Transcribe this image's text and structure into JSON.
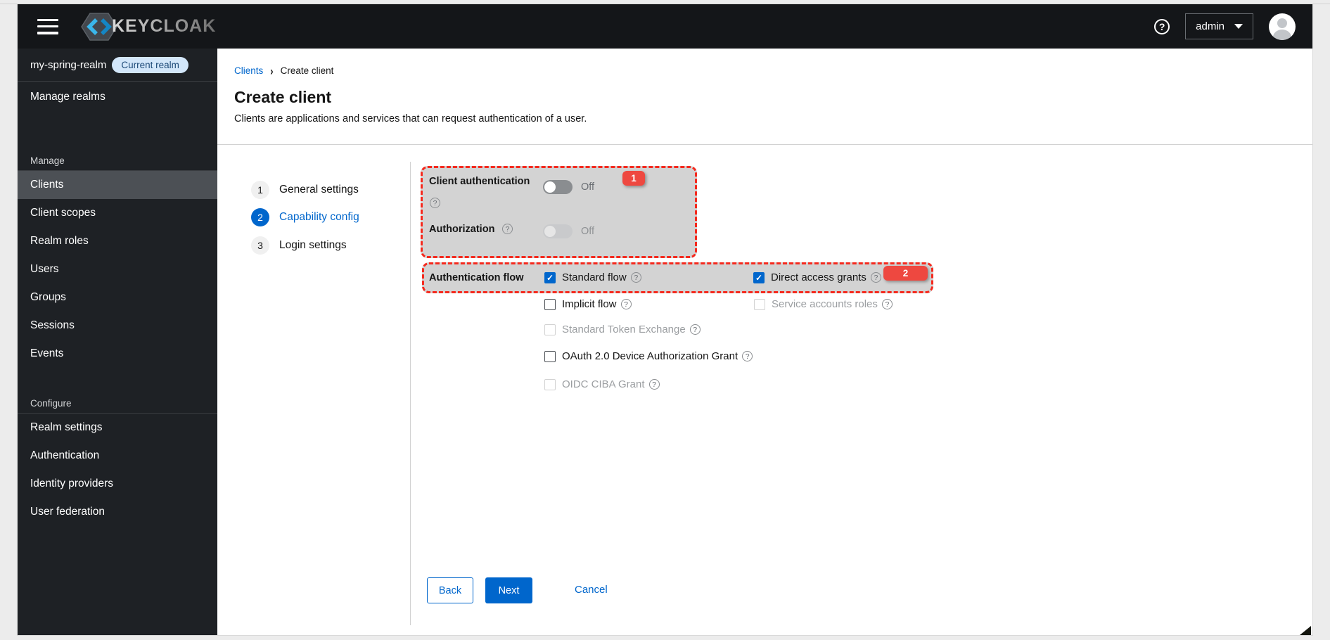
{
  "masthead": {
    "brand": "KEYCLOAK",
    "user_menu": "admin"
  },
  "sidebar": {
    "realm": {
      "name": "my-spring-realm",
      "badge": "Current realm"
    },
    "manage_realms": "Manage realms",
    "manage_group": {
      "label": "Manage",
      "items": [
        {
          "label": "Clients",
          "active": true
        },
        {
          "label": "Client scopes",
          "active": false
        },
        {
          "label": "Realm roles",
          "active": false
        },
        {
          "label": "Users",
          "active": false
        },
        {
          "label": "Groups",
          "active": false
        },
        {
          "label": "Sessions",
          "active": false
        },
        {
          "label": "Events",
          "active": false
        }
      ]
    },
    "configure_group": {
      "label": "Configure",
      "items": [
        {
          "label": "Realm settings",
          "active": false
        },
        {
          "label": "Authentication",
          "active": false
        },
        {
          "label": "Identity providers",
          "active": false
        },
        {
          "label": "User federation",
          "active": false
        }
      ]
    }
  },
  "breadcrumb": {
    "parent": "Clients",
    "current": "Create client"
  },
  "page": {
    "title": "Create client",
    "description": "Clients are applications and services that can request authentication of a user."
  },
  "wizard": {
    "steps": [
      {
        "num": "1",
        "label": "General settings",
        "active": false
      },
      {
        "num": "2",
        "label": "Capability config",
        "active": true
      },
      {
        "num": "3",
        "label": "Login settings",
        "active": false
      }
    ]
  },
  "form": {
    "client_auth": {
      "label": "Client authentication",
      "value": "Off",
      "disabled": false
    },
    "authorization": {
      "label": "Authorization",
      "value": "Off",
      "disabled": true
    },
    "auth_flow_label": "Authentication flow",
    "checkboxes": [
      {
        "label": "Standard flow",
        "checked": true,
        "disabled": false
      },
      {
        "label": "Direct access grants",
        "checked": true,
        "disabled": false
      },
      {
        "label": "Implicit flow",
        "checked": false,
        "disabled": false
      },
      {
        "label": "Service accounts roles",
        "checked": false,
        "disabled": true
      },
      {
        "label": "Standard Token Exchange",
        "checked": false,
        "disabled": true
      },
      {
        "label": "OAuth 2.0 Device Authorization Grant",
        "checked": false,
        "disabled": false
      },
      {
        "label": "OIDC CIBA Grant",
        "checked": false,
        "disabled": true
      }
    ],
    "buttons": {
      "back": "Back",
      "next": "Next",
      "cancel": "Cancel"
    }
  },
  "annotations": [
    {
      "number": "1"
    },
    {
      "number": "2"
    }
  ],
  "colors": {
    "accent": "#0066cc",
    "annotation_red": "#f5291d",
    "badge_red": "#ee4840",
    "masthead_bg": "#141619",
    "sidebar_bg": "#1e2125",
    "overlay_gray": "#d3d3d3"
  }
}
